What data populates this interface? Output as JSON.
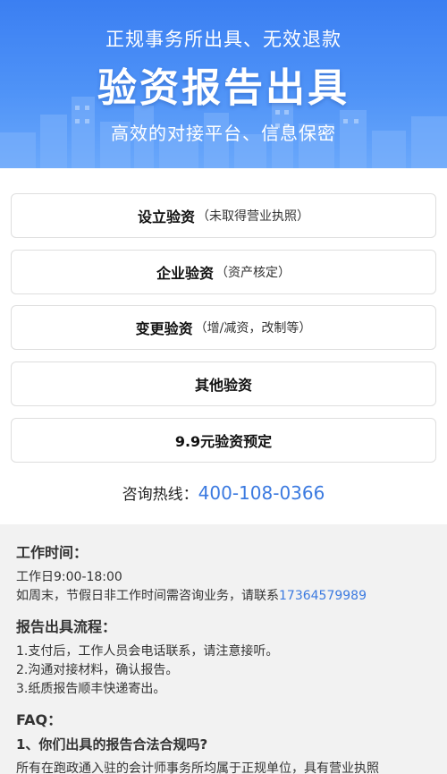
{
  "banner": {
    "top_text": "正规事务所出具、无效退款",
    "main_text": "验资报告出具",
    "sub_text": "高效的对接平台、信息保密"
  },
  "options": [
    {
      "main": "设立验资",
      "note": "（未取得营业执照）"
    },
    {
      "main": "企业验资",
      "note": "（资产核定）"
    },
    {
      "main": "变更验资",
      "note": "（增/减资，改制等）"
    },
    {
      "main": "其他验资",
      "note": ""
    },
    {
      "main": "9.9元验资预定",
      "note": ""
    }
  ],
  "hotline": {
    "label": "咨询热线：",
    "number": "400-108-0366"
  },
  "info": {
    "work_time_title": "工作时间：",
    "work_time_line1": "工作日9:00-18:00",
    "work_time_line2": "如周末，节假日非工作时间需咨询业务，请联系",
    "work_time_phone": "17364579989",
    "process_title": "报告出具流程：",
    "process_steps": [
      "1.支付后，工作人员会电话联系，请注意接听。",
      "2.沟通对接材料，确认报告。",
      "3.纸质报告顺丰快递寄出。"
    ],
    "faq_title": "FAQ：",
    "faq_q1": "1、你们出具的报告合法合规吗?",
    "faq_a1": "所有在跑政通入驻的会计师事务所均属于正规单位，具有营业执照"
  },
  "colors": {
    "banner_blue": "#3b7ff2",
    "link_blue": "#3b7ae0",
    "info_bg": "#f2f2f2"
  }
}
